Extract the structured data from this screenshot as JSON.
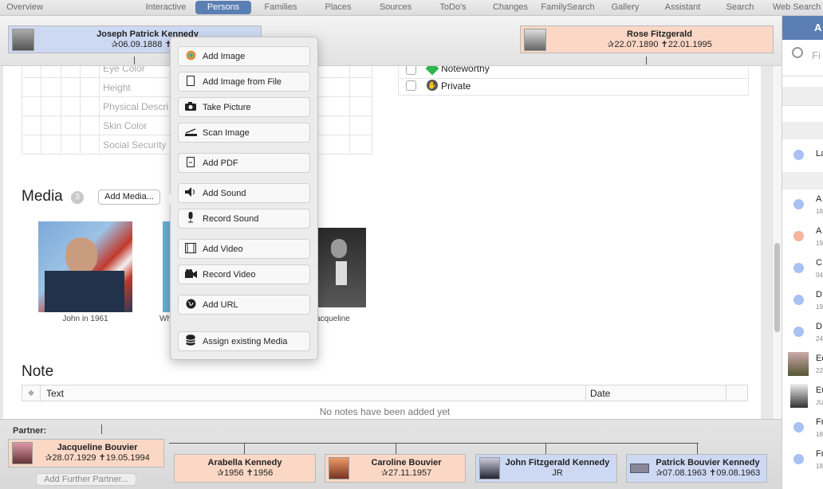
{
  "tabs": [
    {
      "label": "Overview",
      "active": false
    },
    {
      "label": "Interactive",
      "active": false
    },
    {
      "label": "Persons",
      "active": true
    },
    {
      "label": "Families",
      "active": false
    },
    {
      "label": "Places",
      "active": false
    },
    {
      "label": "Sources",
      "active": false
    },
    {
      "label": "ToDo's",
      "active": false
    },
    {
      "label": "Changes",
      "active": false
    },
    {
      "label": "FamilySearch",
      "active": false
    },
    {
      "label": "Gallery",
      "active": false
    },
    {
      "label": "Assistant",
      "active": false
    },
    {
      "label": "Search",
      "active": false
    },
    {
      "label": "Web Search",
      "active": false
    }
  ],
  "parents": {
    "father": {
      "name": "Joseph Patrick Kennedy",
      "dates": "✰06.09.1888 ✝18."
    },
    "mother": {
      "name": "Rose Fitzgerald",
      "dates": "✰22.07.1890 ✝22.01.1995"
    }
  },
  "attributes": {
    "rows": [
      "Eye Color",
      "Height",
      "Physical Descri",
      "Skin Color",
      "Social Security"
    ]
  },
  "flags": [
    {
      "label": "Noteworthy",
      "icon": "green-diamond-icon"
    },
    {
      "label": "Private",
      "icon": "private-icon"
    }
  ],
  "media": {
    "title": "Media",
    "count": "3",
    "add_button": "Add Media...",
    "items": [
      {
        "caption": "John in 1961"
      },
      {
        "caption": "Wh"
      },
      {
        "caption": "acqueline"
      }
    ]
  },
  "popup": {
    "items": [
      {
        "label": "Add Image",
        "icon": "color-wheel-icon"
      },
      {
        "label": "Add Image from File",
        "icon": "file-icon"
      },
      {
        "label": "Take Picture",
        "icon": "camera-icon"
      },
      {
        "label": "Scan Image",
        "icon": "scanner-icon"
      },
      {
        "label": "Add PDF",
        "icon": "pdf-icon"
      },
      {
        "label": "Add Sound",
        "icon": "speaker-icon"
      },
      {
        "label": "Record Sound",
        "icon": "microphone-icon"
      },
      {
        "label": "Add Video",
        "icon": "film-icon"
      },
      {
        "label": "Record Video",
        "icon": "video-camera-icon"
      },
      {
        "label": "Add URL",
        "icon": "globe-icon"
      },
      {
        "label": "Assign existing Media",
        "icon": "database-icon"
      }
    ]
  },
  "note": {
    "title": "Note",
    "col_text": "Text",
    "col_date": "Date",
    "empty": "No notes have been added yet"
  },
  "sidebar": {
    "header": "A",
    "search_placeholder": "Fi",
    "items": [
      {
        "t": "La",
        "s": "",
        "color": "#a9c1f1"
      },
      {
        "t": "A",
        "s": "18",
        "color": "#a9c1f1"
      },
      {
        "t": "A",
        "s": "19",
        "color": "#f5b59b"
      },
      {
        "t": "C",
        "s": "04",
        "color": "#a9c1f1"
      },
      {
        "t": "D",
        "s": "19",
        "color": "#a9c1f1"
      },
      {
        "t": "D",
        "s": "24",
        "color": "#a9c1f1"
      },
      {
        "t": "Ed",
        "s": "22",
        "color": "photo"
      },
      {
        "t": "Eu",
        "s": "JU",
        "color": "photo"
      },
      {
        "t": "Fr",
        "s": "18",
        "color": "#a9c1f1"
      },
      {
        "t": "Fr",
        "s": "18",
        "color": "#a9c1f1"
      }
    ]
  },
  "bottom": {
    "partner_label": "Partner:",
    "partner": {
      "name": "Jacqueline Bouvier",
      "dates": "✰28.07.1929 ✝19.05.1994"
    },
    "add_partner": "Add Further Partner...",
    "children": [
      {
        "name": "Arabella Kennedy",
        "dates": "✰1956 ✝1956",
        "color": "pink"
      },
      {
        "name": "Caroline Bouvier",
        "dates": "✰27.11.1957",
        "color": "pink"
      },
      {
        "name": "John Fitzgerald Kennedy",
        "dates": "JR",
        "color": "blue"
      },
      {
        "name": "Patrick Bouvier Kennedy",
        "dates": "✰07.08.1963 ✝09.08.1963",
        "color": "blue"
      }
    ]
  }
}
